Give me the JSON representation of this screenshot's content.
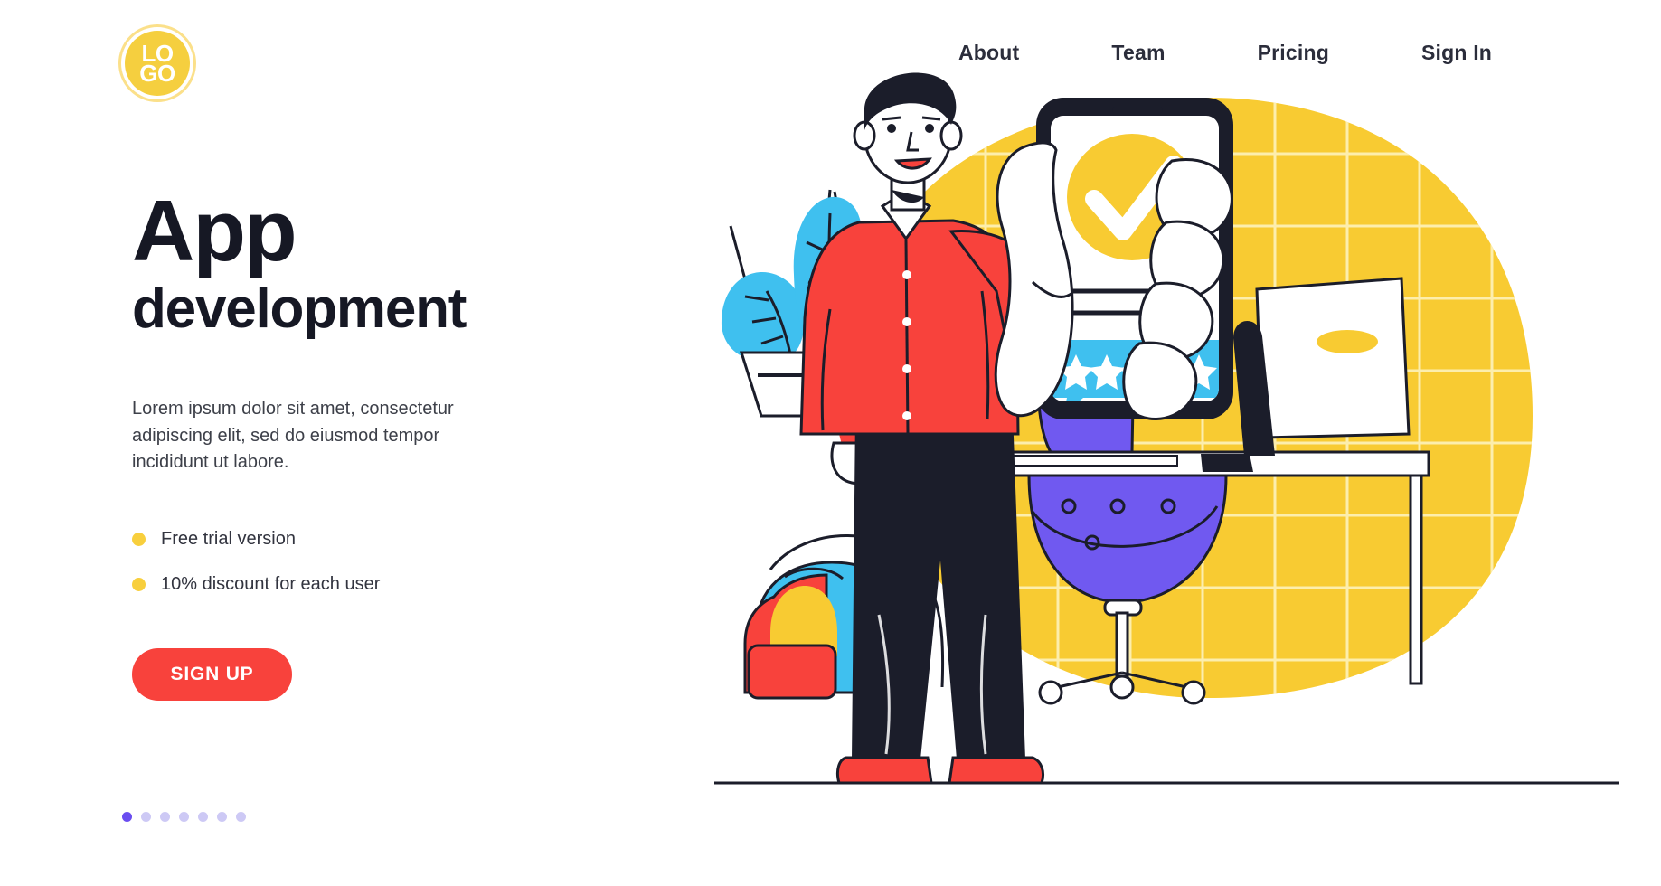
{
  "header": {
    "logo": {
      "line1": "LO",
      "line2": "GO",
      "name": "logo"
    },
    "nav": [
      {
        "label": "About"
      },
      {
        "label": "Team"
      },
      {
        "label": "Pricing"
      },
      {
        "label": "Sign In"
      }
    ]
  },
  "hero": {
    "heading_line1": "App",
    "heading_line2": "development",
    "paragraph": "Lorem ipsum dolor sit amet, consectetur adipiscing elit, sed do eiusmod tempor incididunt ut labore.",
    "features": [
      {
        "label": "Free trial version"
      },
      {
        "label": "10% discount for each user"
      }
    ],
    "cta_label": "SIGN UP"
  },
  "carousel": {
    "total_dots": 7,
    "active_index": 0
  },
  "illustration": {
    "description": "Man in red shirt holding a smartphone showing an approval checkmark and a five-star review",
    "phone": {
      "checkmark": "check-icon",
      "stars": 5,
      "text_lines": 2
    },
    "objects": [
      "hanging-plant",
      "backpack",
      "office-chair",
      "desk",
      "monitor"
    ]
  },
  "colors": {
    "yellow": "#f8cb32",
    "yellow_light": "#ffd84d",
    "red": "#f8423c",
    "blue": "#3fc0ef",
    "purple": "#7059f0",
    "dark": "#1b1d2a",
    "white": "#ffffff",
    "pager_active": "#6a4df0",
    "pager_inactive": "#cdc9f5"
  }
}
